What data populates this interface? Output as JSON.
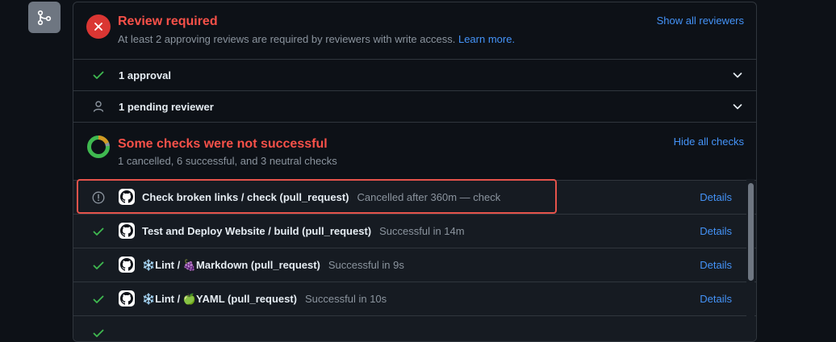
{
  "review": {
    "title": "Review required",
    "subtitle": "At least 2 approving reviews are required by reviewers with write access.",
    "learn_more": "Learn more.",
    "show_all": "Show all reviewers",
    "rows": [
      {
        "label": "1 approval",
        "icon": "check-icon"
      },
      {
        "label": "1 pending reviewer",
        "icon": "person-icon"
      }
    ]
  },
  "checks": {
    "title": "Some checks were not successful",
    "subtitle": "1 cancelled, 6 successful, and 3 neutral checks",
    "toggle": "Hide all checks",
    "items": [
      {
        "name": "Check broken links / check (pull_request)",
        "desc": "Cancelled after 360m — check",
        "status": "cancelled",
        "details": "Details"
      },
      {
        "name": "Test and Deploy Website / build (pull_request)",
        "desc": "Successful in 14m",
        "status": "success",
        "details": "Details"
      },
      {
        "name": "❄️Lint / 🍇Markdown (pull_request)",
        "desc": "Successful in 9s",
        "status": "success",
        "details": "Details"
      },
      {
        "name": "❄️Lint / 🍏YAML (pull_request)",
        "desc": "Successful in 10s",
        "status": "success",
        "details": "Details"
      }
    ]
  },
  "colors": {
    "error": "#f85149",
    "success": "#3fb950",
    "link": "#4493f8",
    "muted": "#8b949e"
  }
}
